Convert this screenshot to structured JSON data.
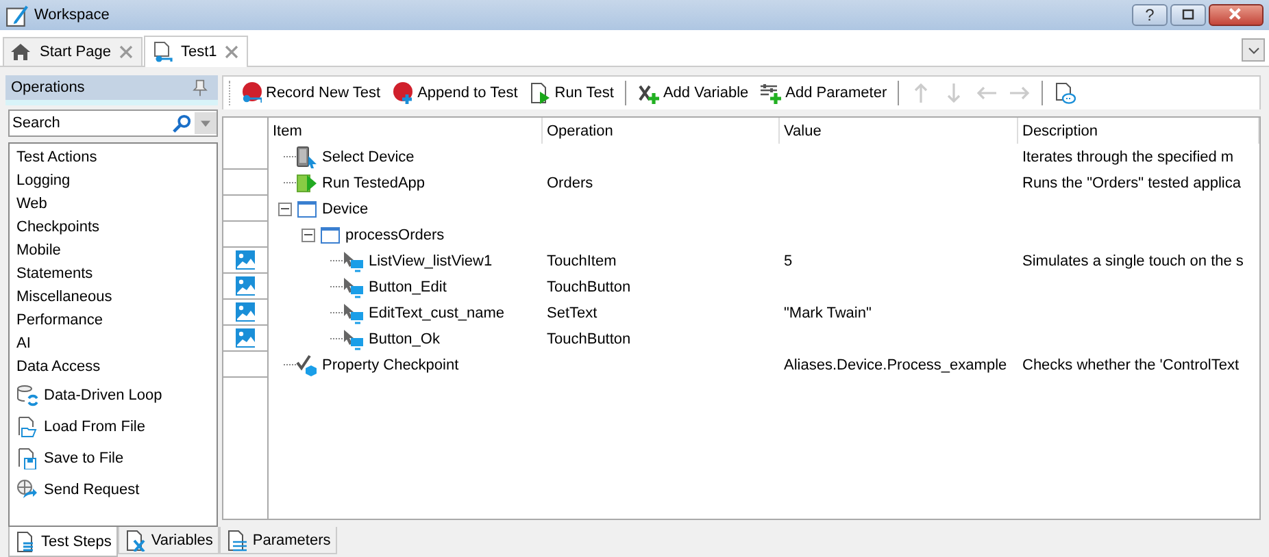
{
  "window": {
    "title": "Workspace",
    "help_button": "?"
  },
  "doc_tabs": [
    {
      "label": "Start Page",
      "kind": "home",
      "selected": false
    },
    {
      "label": "Test1",
      "kind": "test",
      "selected": true
    }
  ],
  "operations": {
    "title": "Operations",
    "search": {
      "placeholder": "Search"
    },
    "categories": [
      "Test Actions",
      "Logging",
      "Web",
      "Checkpoints",
      "Mobile",
      "Statements",
      "Miscellaneous",
      "Performance",
      "AI",
      "Data Access"
    ],
    "tools": [
      {
        "label": "Data-Driven Loop",
        "kind": "loop"
      },
      {
        "label": "Load From File",
        "kind": "load"
      },
      {
        "label": "Save to File",
        "kind": "save"
      },
      {
        "label": "Send Request",
        "kind": "request"
      }
    ]
  },
  "toolbar": [
    {
      "kind": "record",
      "label": "Record New Test",
      "disabled": false
    },
    {
      "kind": "append",
      "label": "Append to Test",
      "disabled": false
    },
    {
      "kind": "run",
      "label": "Run Test",
      "disabled": false
    },
    {
      "kind": "separator"
    },
    {
      "kind": "variable",
      "label": "Add Variable",
      "disabled": false
    },
    {
      "kind": "parameter",
      "label": "Add Parameter",
      "disabled": false
    },
    {
      "kind": "separator"
    },
    {
      "kind": "up",
      "disabled": true
    },
    {
      "kind": "down",
      "disabled": true
    },
    {
      "kind": "left",
      "disabled": true
    },
    {
      "kind": "right",
      "disabled": true
    },
    {
      "kind": "separator"
    },
    {
      "kind": "comment",
      "disabled": false
    }
  ],
  "grid": {
    "columns": [
      "Item",
      "Operation",
      "Value",
      "Description"
    ],
    "rows": [
      {
        "item": "Select Device",
        "kind": "device",
        "description": "Iterates through the specified m",
        "screenshot": false
      },
      {
        "item": "Run TestedApp",
        "kind": "app",
        "operation": "Orders",
        "description": "Runs the \"Orders\" tested applica",
        "screenshot": false
      },
      {
        "item": "Device",
        "kind": "window",
        "screenshot": false,
        "expanded": true,
        "children": [
          {
            "item": "processOrders",
            "kind": "window",
            "screenshot": false,
            "expanded": true,
            "children": [
              {
                "item": "ListView_listView1",
                "kind": "action",
                "operation": "TouchItem",
                "value": "5",
                "description": "Simulates a single touch on the s",
                "screenshot": true
              },
              {
                "item": "Button_Edit",
                "kind": "action",
                "operation": "TouchButton",
                "screenshot": true
              },
              {
                "item": "EditText_cust_name",
                "kind": "action",
                "operation": "SetText",
                "value": "\"Mark Twain\"",
                "screenshot": true
              },
              {
                "item": "Button_Ok",
                "kind": "action",
                "operation": "TouchButton",
                "screenshot": true
              }
            ]
          }
        ]
      },
      {
        "item": "Property Checkpoint",
        "kind": "checkpoint",
        "value": "Aliases.Device.Process_example",
        "description": "Checks whether the 'ControlText",
        "screenshot": false
      }
    ]
  },
  "bottom_tabs": [
    {
      "label": "Test Steps",
      "kind": "steps",
      "selected": true
    },
    {
      "label": "Variables",
      "kind": "variables",
      "selected": false
    },
    {
      "label": "Parameters",
      "kind": "parameters",
      "selected": false
    }
  ]
}
